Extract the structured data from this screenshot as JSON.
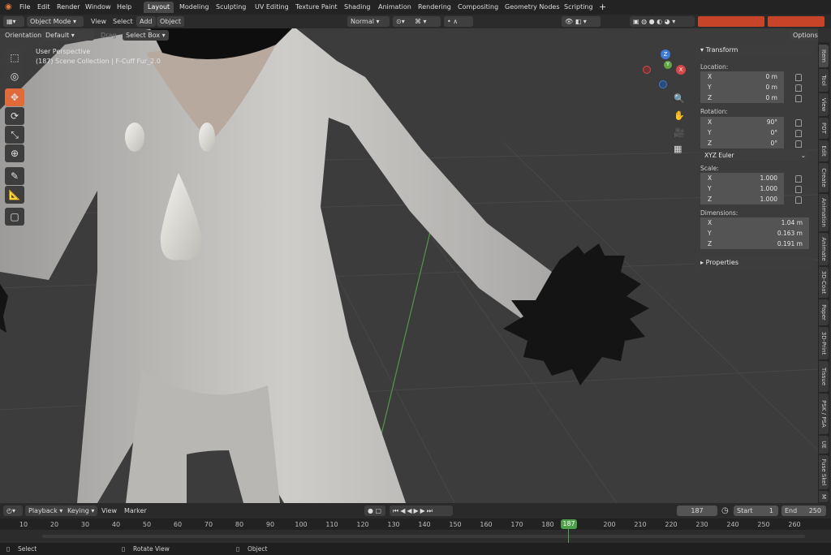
{
  "menu": {
    "file": "File",
    "edit": "Edit",
    "render": "Render",
    "window": "Window",
    "help": "Help"
  },
  "workspaces": [
    "Layout",
    "Modeling",
    "Sculpting",
    "UV Editing",
    "Texture Paint",
    "Shading",
    "Animation",
    "Rendering",
    "Compositing",
    "Geometry Nodes",
    "Scripting"
  ],
  "header": {
    "mode": "Object Mode",
    "view": "View",
    "select": "Select",
    "add": "Add",
    "object": "Object",
    "orientation_label": "Orientation:",
    "orientation_value": "Default",
    "drag_label": "Drag",
    "drag_value": "Select Box",
    "pivot": "Normal",
    "options": "Options"
  },
  "viewport": {
    "perspective": "User Perspective",
    "collection": "(187) Scene Collection | F-Cuff Fur_2.0",
    "gizmo": {
      "x": "X",
      "y": "Y",
      "z": "Z"
    }
  },
  "transform": {
    "title": "Transform",
    "location_label": "Location:",
    "location": [
      {
        "axis": "X",
        "value": "0 m"
      },
      {
        "axis": "Y",
        "value": "0 m"
      },
      {
        "axis": "Z",
        "value": "0 m"
      }
    ],
    "rotation_label": "Rotation:",
    "rotation": [
      {
        "axis": "X",
        "value": "90°"
      },
      {
        "axis": "Y",
        "value": "0°"
      },
      {
        "axis": "Z",
        "value": "0°"
      }
    ],
    "rotation_mode": "XYZ Euler",
    "scale_label": "Scale:",
    "scale": [
      {
        "axis": "X",
        "value": "1.000"
      },
      {
        "axis": "Y",
        "value": "1.000"
      },
      {
        "axis": "Z",
        "value": "1.000"
      }
    ],
    "dimensions_label": "Dimensions:",
    "dimensions": [
      {
        "axis": "X",
        "value": "1.04 m"
      },
      {
        "axis": "Y",
        "value": "0.163 m"
      },
      {
        "axis": "Z",
        "value": "0.191 m"
      }
    ]
  },
  "properties": {
    "title": "Properties"
  },
  "sidebar_tabs": [
    "Item",
    "Tool",
    "View",
    "PDT",
    "Edit",
    "Create",
    "Animation",
    "Animate",
    "3D-Coat",
    "Paper",
    "3D-Print",
    "Tissue",
    "PSK / PSA",
    "UE",
    "Fuse Skel",
    "M"
  ],
  "timeline": {
    "playback": "Playback",
    "keying": "Keying",
    "view": "View",
    "marker": "Marker",
    "current_frame": "187",
    "start_label": "Start",
    "start": "1",
    "end_label": "End",
    "end": "250",
    "ticks": [
      "10",
      "20",
      "30",
      "40",
      "50",
      "60",
      "70",
      "80",
      "90",
      "100",
      "110",
      "120",
      "130",
      "140",
      "150",
      "160",
      "170",
      "180",
      "187",
      "200",
      "210",
      "220",
      "230",
      "240",
      "250",
      "260"
    ]
  },
  "status": {
    "select": "Select",
    "rotate": "Rotate View",
    "object": "Object"
  },
  "colors": {
    "accent": "#e06a3a",
    "active_tab": "#4a4a4a",
    "frame_marker": "#4ca14a"
  }
}
